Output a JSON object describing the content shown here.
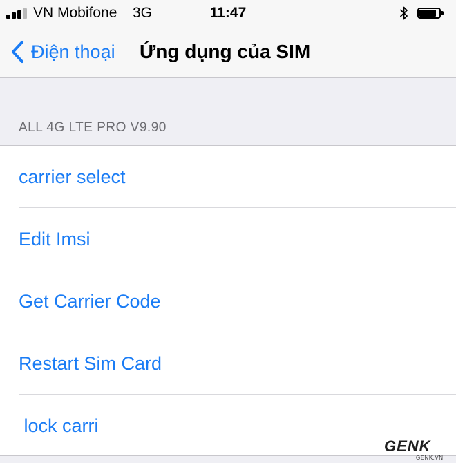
{
  "status_bar": {
    "carrier": "VN Mobifone",
    "network": "3G",
    "time": "11:47",
    "signal_bars_filled": 3,
    "signal_bars_total": 4,
    "icons": [
      "signal-icon",
      "bluetooth-icon",
      "battery-icon"
    ]
  },
  "nav": {
    "back_label": "Điện thoại",
    "title": "Ứng dụng của SIM"
  },
  "section": {
    "header": "ALL 4G LTE PRO V9.90"
  },
  "items": [
    {
      "label": "carrier select"
    },
    {
      "label": "Edit Imsi"
    },
    {
      "label": "Get Carrier Code"
    },
    {
      "label": "Restart Sim Card"
    },
    {
      "label": " lock carri"
    }
  ],
  "watermark": {
    "logo": "GENK",
    "sub": "GENK.VN"
  },
  "colors": {
    "accent": "#1a7cf5",
    "background": "#efeff4",
    "bar": "#f7f7f7",
    "section_header": "#6d6d72"
  }
}
